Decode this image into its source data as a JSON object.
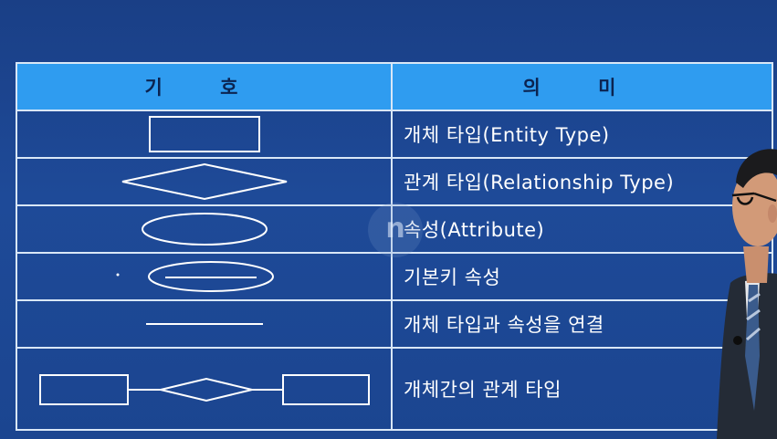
{
  "table": {
    "header": {
      "symbol": "기 호",
      "meaning": "의 미"
    },
    "rows": [
      {
        "symbol": "rectangle",
        "meaning": "개체 타입(Entity Type)"
      },
      {
        "symbol": "diamond",
        "meaning": "관계 타입(Relationship Type)"
      },
      {
        "symbol": "ellipse",
        "meaning": "속성(Attribute)"
      },
      {
        "symbol": "ellipse-underline",
        "meaning": "기본키 속성"
      },
      {
        "symbol": "line",
        "meaning": "개체 타입과 속성을 연결"
      },
      {
        "symbol": "entity-relationship-entity",
        "meaning": "개체간의 관계 타입"
      }
    ]
  },
  "watermark": "n",
  "colors": {
    "background": "#1e4a98",
    "header_fill": "#2f9cf0",
    "header_text": "#0b2350",
    "grid_line": "#d9e7f7",
    "text": "#ffffff"
  }
}
